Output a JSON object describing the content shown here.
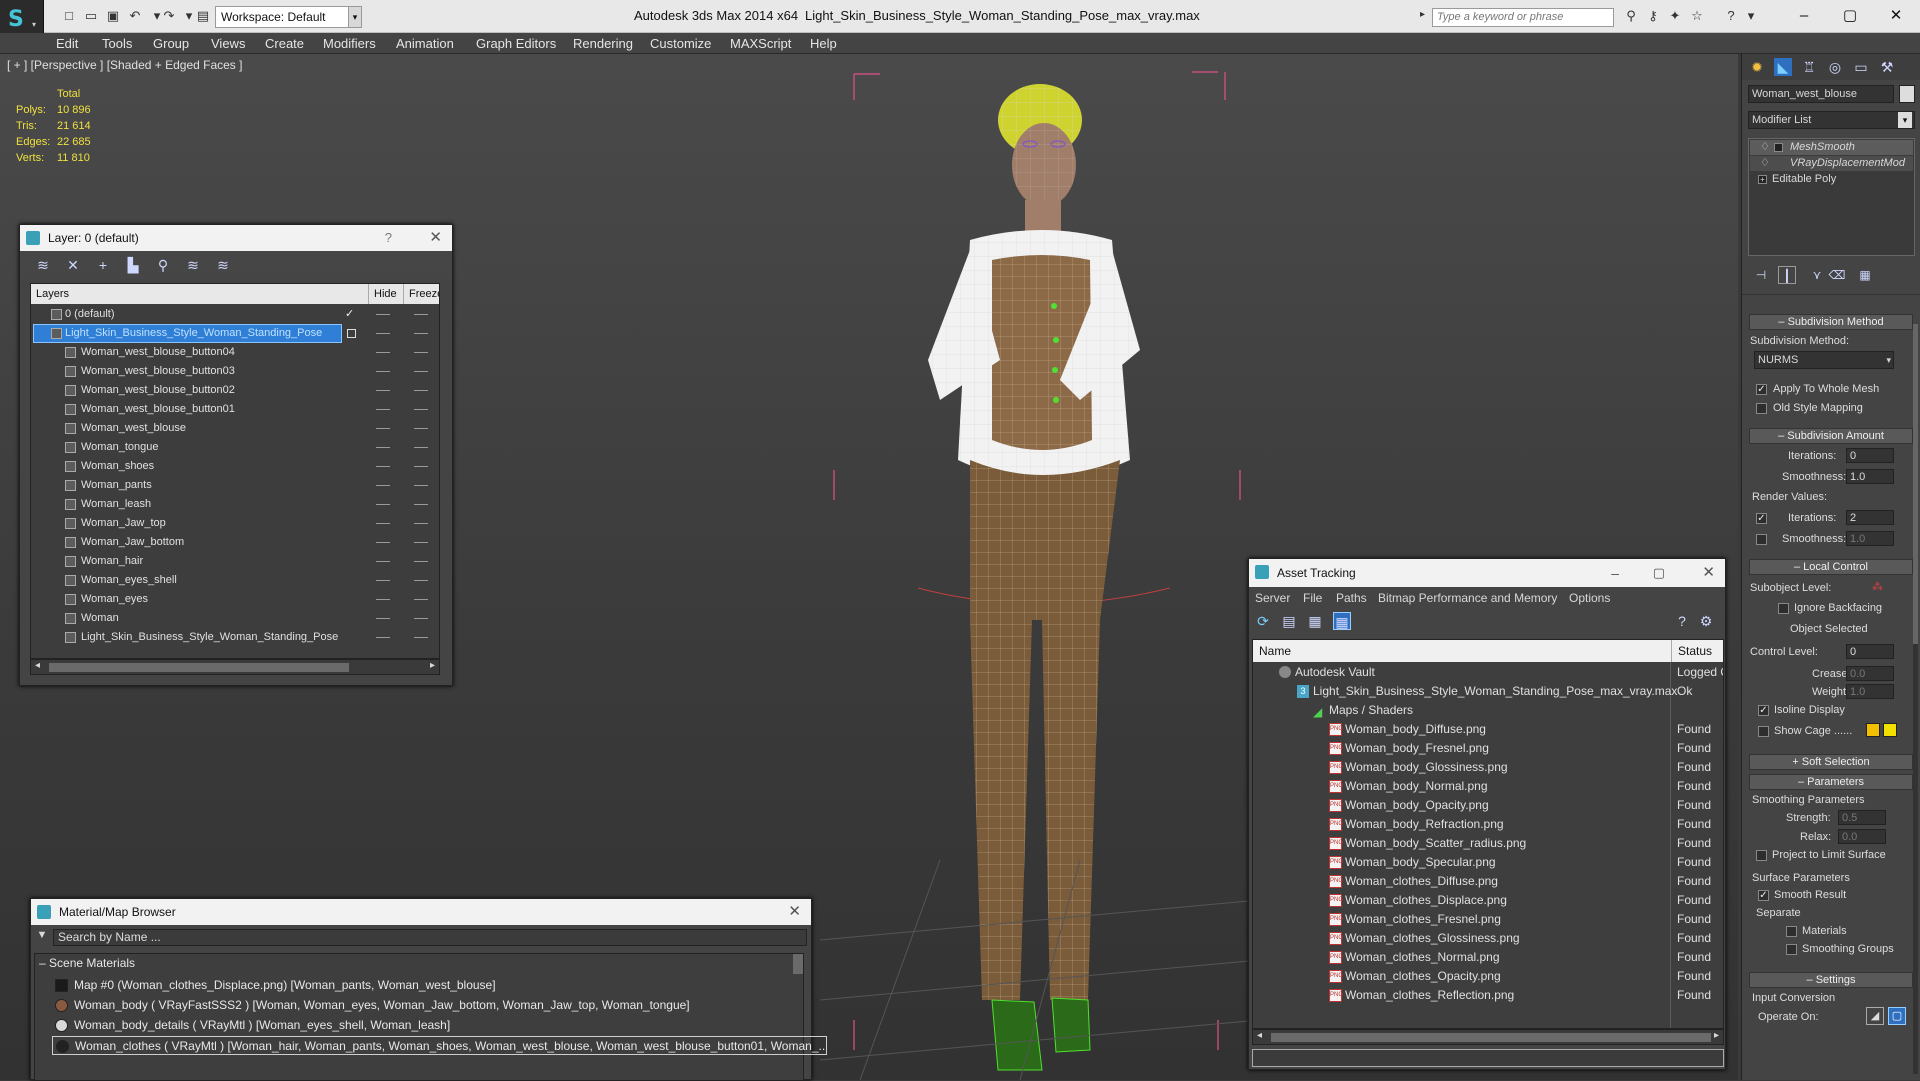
{
  "titlebar": {
    "workspace": "Workspace: Default",
    "app_title": "Autodesk 3ds Max  2014 x64",
    "file_title": "Light_Skin_Business_Style_Woman_Standing_Pose_max_vray.max",
    "search_placeholder": "Type a keyword or phrase"
  },
  "menu": [
    "Edit",
    "Tools",
    "Group",
    "Views",
    "Create",
    "Modifiers",
    "Animation",
    "Graph Editors",
    "Rendering",
    "Customize",
    "MAXScript",
    "Help"
  ],
  "viewport": {
    "label": "[ + ] [Perspective ] [Shaded + Edged Faces ]",
    "stats": {
      "total_label": "Total",
      "rows": [
        {
          "label": "Polys:",
          "value": "10 896"
        },
        {
          "label": "Tris:",
          "value": "21 614"
        },
        {
          "label": "Edges:",
          "value": "22 685"
        },
        {
          "label": "Verts:",
          "value": "11 810"
        }
      ]
    }
  },
  "layer_panel": {
    "title": "Layer: 0 (default)",
    "help": "?",
    "col_layers": "Layers",
    "col_hide": "Hide",
    "col_freeze": "Freeze",
    "rows": [
      "0 (default)",
      "Light_Skin_Business_Style_Woman_Standing_Pose",
      "Woman_west_blouse_button04",
      "Woman_west_blouse_button03",
      "Woman_west_blouse_button02",
      "Woman_west_blouse_button01",
      "Woman_west_blouse",
      "Woman_tongue",
      "Woman_shoes",
      "Woman_pants",
      "Woman_leash",
      "Woman_Jaw_top",
      "Woman_Jaw_bottom",
      "Woman_hair",
      "Woman_eyes_shell",
      "Woman_eyes",
      "Woman",
      "Light_Skin_Business_Style_Woman_Standing_Pose"
    ]
  },
  "material_browser": {
    "title": "Material/Map Browser",
    "search_placeholder": "Search by Name ...",
    "group": "Scene Materials",
    "rows": [
      "Map #0 (Woman_clothes_Displace.png) [Woman_pants, Woman_west_blouse]",
      "Woman_body  ( VRayFastSSS2 ) [Woman, Woman_eyes, Woman_Jaw_bottom, Woman_Jaw_top, Woman_tongue]",
      "Woman_body_details  ( VRayMtl ) [Woman_eyes_shell, Woman_leash]",
      "Woman_clothes  ( VRayMtl ) [Woman_hair, Woman_pants, Woman_shoes, Woman_west_blouse, Woman_west_blouse_button01, Woman_..."
    ]
  },
  "asset_tracking": {
    "title": "Asset Tracking",
    "menu": [
      "Server",
      "File",
      "Paths",
      "Bitmap Performance and Memory",
      "Options"
    ],
    "col_name": "Name",
    "col_status": "Status",
    "rows": [
      {
        "name": "Autodesk Vault",
        "status": "Logged O"
      },
      {
        "name": "Light_Skin_Business_Style_Woman_Standing_Pose_max_vray.max",
        "status": "Ok"
      },
      {
        "name": "Maps / Shaders",
        "status": ""
      },
      {
        "name": "Woman_body_Diffuse.png",
        "status": "Found"
      },
      {
        "name": "Woman_body_Fresnel.png",
        "status": "Found"
      },
      {
        "name": "Woman_body_Glossiness.png",
        "status": "Found"
      },
      {
        "name": "Woman_body_Normal.png",
        "status": "Found"
      },
      {
        "name": "Woman_body_Opacity.png",
        "status": "Found"
      },
      {
        "name": "Woman_body_Refraction.png",
        "status": "Found"
      },
      {
        "name": "Woman_body_Scatter_radius.png",
        "status": "Found"
      },
      {
        "name": "Woman_body_Specular.png",
        "status": "Found"
      },
      {
        "name": "Woman_clothes_Diffuse.png",
        "status": "Found"
      },
      {
        "name": "Woman_clothes_Displace.png",
        "status": "Found"
      },
      {
        "name": "Woman_clothes_Fresnel.png",
        "status": "Found"
      },
      {
        "name": "Woman_clothes_Glossiness.png",
        "status": "Found"
      },
      {
        "name": "Woman_clothes_Normal.png",
        "status": "Found"
      },
      {
        "name": "Woman_clothes_Opacity.png",
        "status": "Found"
      },
      {
        "name": "Woman_clothes_Reflection.png",
        "status": "Found"
      }
    ]
  },
  "command_panel": {
    "object_name": "Woman_west_blouse",
    "modifier_list": "Modifier List",
    "stack": [
      "MeshSmooth",
      "VRayDisplacementMod",
      "Editable Poly"
    ],
    "subdiv_method_hdr": "Subdivision Method",
    "subdiv_method_label": "Subdivision Method:",
    "subdiv_method_value": "NURMS",
    "apply_whole_mesh": "Apply To Whole Mesh",
    "old_style_mapping": "Old Style Mapping",
    "subdiv_amount_hdr": "Subdivision Amount",
    "iterations_label": "Iterations:",
    "iterations_value": "0",
    "smoothness_label": "Smoothness:",
    "smoothness_value": "1.0",
    "render_values": "Render Values:",
    "r_iterations_label": "Iterations:",
    "r_iterations_value": "2",
    "r_smoothness_label": "Smoothness:",
    "r_smoothness_value": "1.0",
    "local_control_hdr": "Local Control",
    "subobject_level": "Subobject Level:",
    "ignore_backfacing": "Ignore Backfacing",
    "object_selected": "Object Selected",
    "control_level_label": "Control Level:",
    "control_level_value": "0",
    "crease_label": "Crease:",
    "crease_value": "0.0",
    "weight_label": "Weight:",
    "weight_value": "1.0",
    "isoline_display": "Isoline Display",
    "show_cage": "Show Cage ......",
    "soft_selection_hdr": "Soft Selection",
    "parameters_hdr": "Parameters",
    "smoothing_params": "Smoothing Parameters",
    "strength_label": "Strength:",
    "strength_value": "0.5",
    "relax_label": "Relax:",
    "relax_value": "0.0",
    "project_limit": "Project to Limit Surface",
    "surface_params": "Surface Parameters",
    "smooth_result": "Smooth Result",
    "separate": "Separate",
    "materials": "Materials",
    "smoothing_groups": "Smoothing Groups",
    "settings_hdr": "Settings",
    "input_conversion": "Input Conversion",
    "operate_on": "Operate On:"
  },
  "colors": {
    "accent": "#3a7bd5",
    "wire": "#f2f2f2",
    "bounds": "#e0508a",
    "select": "#4fa3e6"
  }
}
